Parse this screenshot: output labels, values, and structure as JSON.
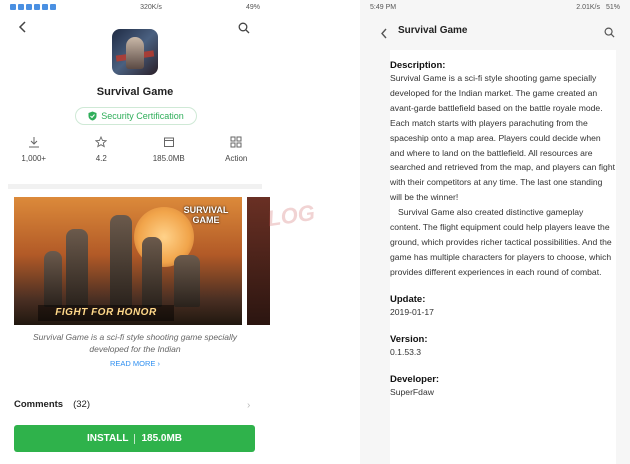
{
  "left": {
    "status": {
      "net": "320K/s",
      "battery": "49%"
    },
    "app_name": "Survival Game",
    "certification": "Security Certification",
    "stats": [
      {
        "value": "1,000+",
        "icon": "download-icon"
      },
      {
        "value": "4.2",
        "icon": "star-icon"
      },
      {
        "value": "185.0MB",
        "icon": "package-icon"
      },
      {
        "value": "Action",
        "icon": "grid-icon"
      }
    ],
    "screenshot": {
      "logo_text": "SURVIVAL GAME",
      "banner_text": "FIGHT FOR HONOR"
    },
    "caption": "Survival Game is a sci-fi style shooting game specially developed for the Indian",
    "read_more": "READ MORE",
    "comments_label": "Comments",
    "comments_count": "(32)",
    "install_label": "INSTALL",
    "install_size": "185.0MB",
    "colors": {
      "accent_green": "#2fb24b",
      "link_blue": "#2f8ff0"
    }
  },
  "watermark": "LOG",
  "right": {
    "status": {
      "time": "5:49 PM",
      "net": "2.01K/s",
      "battery": "51%"
    },
    "header_title": "Survival Game",
    "description_label": "Description:",
    "description_p1": "Survival Game is a sci-fi style shooting game specially developed for the Indian market. The game created an avant-garde battlefield based on the battle royale mode. Each match starts with players parachuting from the spaceship onto a map area. Players could decide when and where to land on the battlefield. All resources are searched and retrieved from the map, and players can fight with their competitors at any time. The last one standing will be the winner!",
    "description_p2": "Survival Game also created distinctive gameplay content. The flight equipment could help players leave the ground, which provides richer tactical possibilities. And the game has multiple characters for players to choose, which provides different experiences in each round of combat.",
    "update_label": "Update:",
    "update_value": "2019-01-17",
    "version_label": "Version:",
    "version_value": "0.1.53.3",
    "developer_label": "Developer:",
    "developer_value": "SuperFdaw"
  }
}
